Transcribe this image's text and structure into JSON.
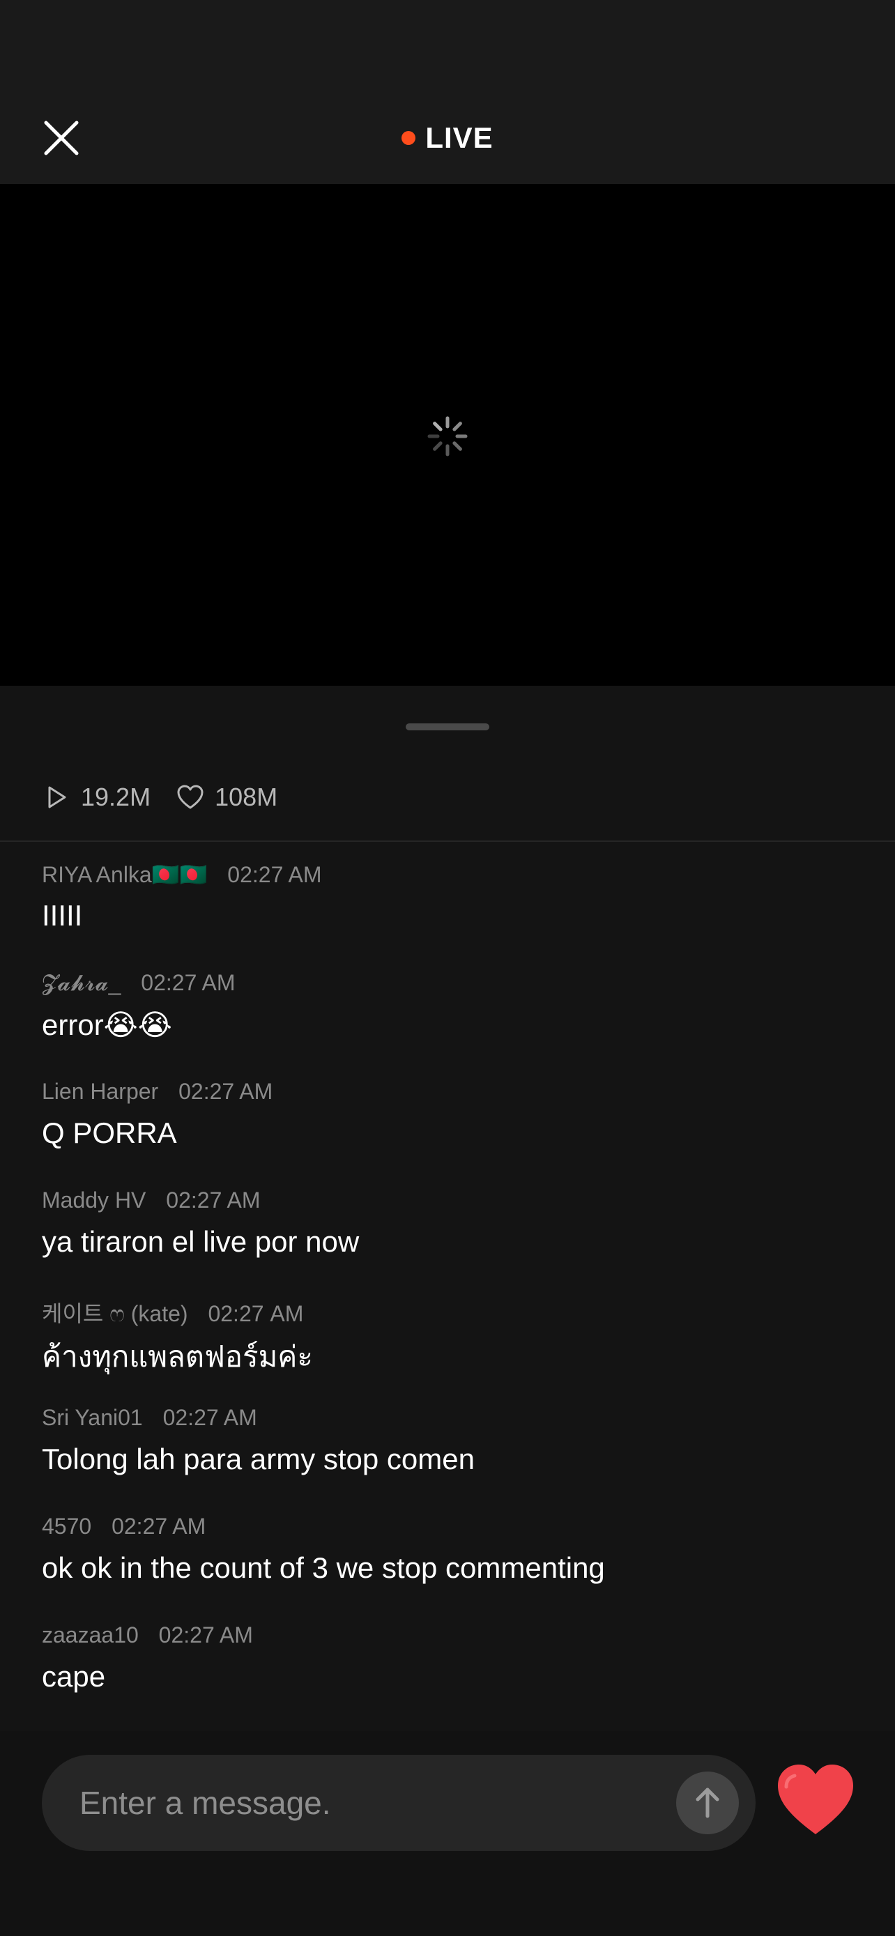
{
  "header": {
    "live_label": "LIVE",
    "live_dot_color": "#FF4D1C",
    "close_icon": "close-icon"
  },
  "video": {
    "state_icon": "loading-spinner-icon"
  },
  "stats": {
    "plays": "19.2M",
    "likes": "108M",
    "plays_icon": "play-icon",
    "likes_icon": "heart-outline-icon"
  },
  "chat": {
    "messages": [
      {
        "user": "RIYA  Anlka🇧🇩🇧🇩",
        "time": "02:27 AM",
        "text": "IIIII"
      },
      {
        "user": "𝓩𝓪𝓱𝓻𝓪_",
        "time": "02:27 AM",
        "text": "error😭😭"
      },
      {
        "user": "Lien Harper",
        "time": "02:27 AM",
        "text": "Q PORRA"
      },
      {
        "user": "Maddy HV",
        "time": "02:27 AM",
        "text": "ya tiraron el live por now"
      },
      {
        "user": "케이트 ෆ (kate)",
        "time": "02:27 AM",
        "text": "ค้างทุกแพลตฟอร์มค่ะ"
      },
      {
        "user": "Sri Yani01",
        "time": "02:27 AM",
        "text": "Tolong lah para army stop comen"
      },
      {
        "user": "4570",
        "time": "02:27 AM",
        "text": "ok ok in  the count of 3 we stop commenting"
      },
      {
        "user": "zaazaa10",
        "time": "02:27 AM",
        "text": "cape"
      }
    ]
  },
  "composer": {
    "placeholder": "Enter a message.",
    "send_icon": "arrow-up-icon",
    "heart_icon": "heart-filled-icon",
    "heart_color": "#F0424A"
  }
}
